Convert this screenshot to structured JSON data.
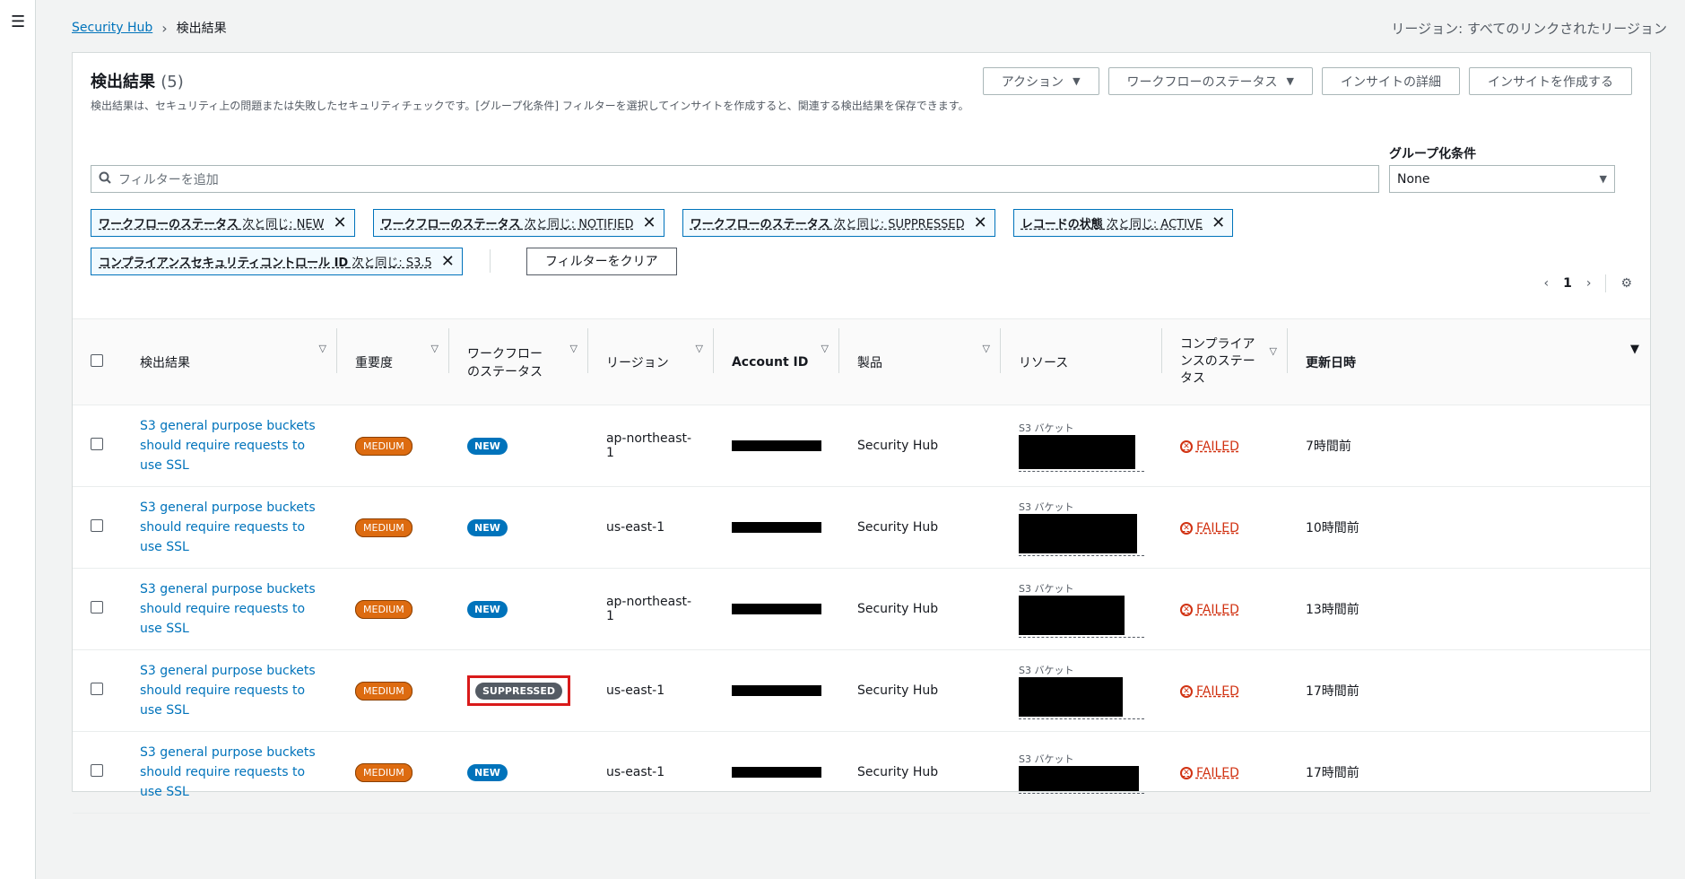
{
  "breadcrumb": [
    "Security Hub",
    "検出結果"
  ],
  "region_text": "リージョン: すべてのリンクされたリージョン",
  "panel": {
    "title": "検出結果",
    "count": "(5)",
    "description": "検出結果は、セキュリティ上の問題または失敗したセキュリティチェックです。[グループ化条件] フィルターを選択してインサイトを作成すると、関連する検出結果を保存できます。",
    "buttons": {
      "action": "アクション",
      "workflow_status": "ワークフローのステータス",
      "insight_details": "インサイトの詳細",
      "create_insight": "インサイトを作成する"
    }
  },
  "filter": {
    "placeholder": "フィルターを追加",
    "group_label": "グループ化条件",
    "group_value": "None"
  },
  "tokens": [
    {
      "key": "ワークフローのステータス",
      "rest": " 次と同じ: NEW"
    },
    {
      "key": "ワークフローのステータス",
      "rest": " 次と同じ: NOTIFIED"
    },
    {
      "key": "ワークフローのステータス",
      "rest": " 次と同じ: SUPPRESSED"
    },
    {
      "key": "レコードの状態",
      "rest": " 次と同じ: ACTIVE"
    },
    {
      "key": "コンプライアンスセキュリティコントロール ID",
      "rest": " 次と同じ: S3.5"
    }
  ],
  "clear_filters": "フィルターをクリア",
  "pagination": {
    "current": "1"
  },
  "columns": {
    "finding": "検出結果",
    "severity": "重要度",
    "workflow": "ワークフロー\nのステータス",
    "region": "リージョン",
    "account": "Account ID",
    "product": "製品",
    "resource": "リソース",
    "compliance": "コンプライア\nンスのステー\nタス",
    "updated": "更新日時"
  },
  "rows": [
    {
      "finding": "S3 general purpose buckets should require requests to use SSL",
      "severity": "MEDIUM",
      "workflow": "NEW",
      "region": "ap-northeast-1",
      "product": "Security Hub",
      "resource_label": "S3 バケット",
      "compliance": "FAILED",
      "updated": "7時間前"
    },
    {
      "finding": "S3 general purpose buckets should require requests to use SSL",
      "severity": "MEDIUM",
      "workflow": "NEW",
      "region": "us-east-1",
      "product": "Security Hub",
      "resource_label": "S3 バケット",
      "compliance": "FAILED",
      "updated": "10時間前"
    },
    {
      "finding": "S3 general purpose buckets should require requests to use SSL",
      "severity": "MEDIUM",
      "workflow": "NEW",
      "region": "ap-northeast-1",
      "product": "Security Hub",
      "resource_label": "S3 バケット",
      "compliance": "FAILED",
      "updated": "13時間前"
    },
    {
      "finding": "S3 general purpose buckets should require requests to use SSL",
      "severity": "MEDIUM",
      "workflow": "SUPPRESSED",
      "region": "us-east-1",
      "product": "Security Hub",
      "resource_label": "S3 バケット",
      "compliance": "FAILED",
      "updated": "17時間前"
    },
    {
      "finding": "S3 general purpose buckets should require requests to use SSL",
      "severity": "MEDIUM",
      "workflow": "NEW",
      "region": "us-east-1",
      "product": "Security Hub",
      "resource_label": "S3 バケット",
      "compliance": "FAILED",
      "updated": "17時間前"
    }
  ],
  "colors": {
    "link": "#0073bb",
    "severity_medium": "#dd6b10",
    "failed": "#d13212",
    "highlight": "#d91a1a"
  }
}
